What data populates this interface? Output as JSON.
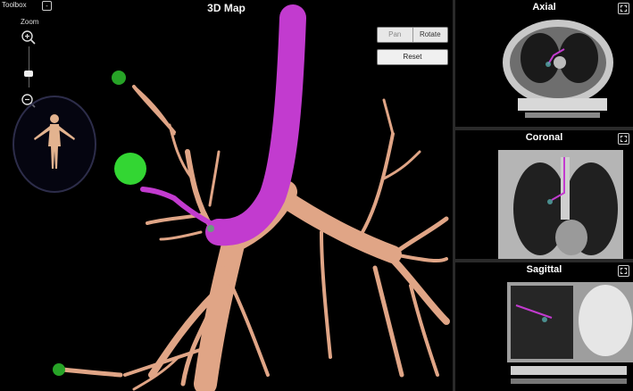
{
  "main": {
    "title": "3D Map",
    "toolbox_label": "Toolbox",
    "toolbox_toggle": "-",
    "zoom_label": "Zoom",
    "zoom_level": 0.5,
    "pan_label": "Pan",
    "rotate_label": "Rotate",
    "reset_label": "Reset"
  },
  "views": {
    "axial": {
      "title": "Axial"
    },
    "coronal": {
      "title": "Coronal"
    },
    "sagittal": {
      "title": "Sagittal"
    }
  },
  "colors": {
    "airway": "#e0a586",
    "path": "#c23bcf",
    "target": "#33d633",
    "background": "#000000"
  }
}
